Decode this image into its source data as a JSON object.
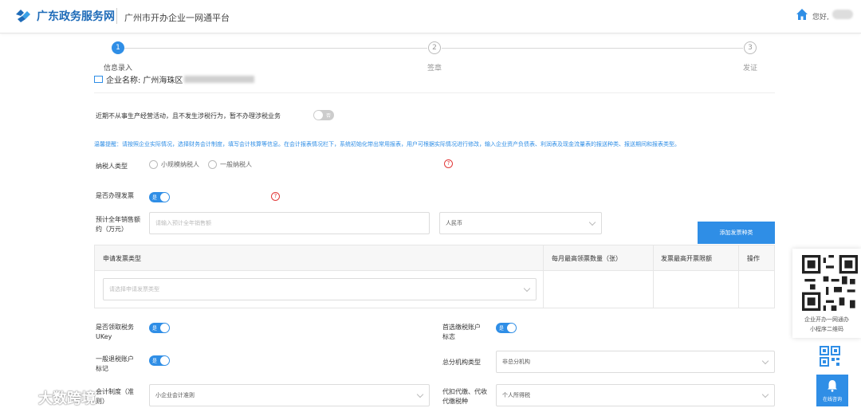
{
  "header": {
    "site_name": "广东政务服务网",
    "subtitle": "广州市开办企业一网通平台",
    "greeting": "您好,"
  },
  "steps": [
    {
      "number": "1",
      "label": "信息录入"
    },
    {
      "number": "2",
      "label": "签章"
    },
    {
      "number": "3",
      "label": "发证"
    }
  ],
  "company": {
    "label": "企业名称:",
    "value": "广州海珠区"
  },
  "form": {
    "no_business_text": "近期不从事生产经营活动，且不发生涉税行为，暂不办理涉税业务",
    "no_business_toggle": "否",
    "tip": "温馨提醒：请按照企业实际情况，选择财务会计制度，填写会计核算等信息。在会计报表情况栏下，系统初始化带出常用报表，用户可根据实际情况进行修改，输入企业资产负债表、利润表及现金流量表的报送种类、报送期间和报表类型。",
    "taxpayer_type_label": "纳税人类型",
    "taxpayer_options": [
      "小规模纳税人",
      "一般纳税人"
    ],
    "invoice_label": "是否办理发票",
    "invoice_toggle": "是",
    "sales_label": "预计全年销售额约（万元）",
    "sales_placeholder": "请输入预计全年销售额",
    "currency_value": "人民币",
    "add_invoice_button": "添加发票种类",
    "table_headers": [
      "申请发票类型",
      "每月最高领票数量（张）",
      "发票最高开票限额",
      "操作"
    ],
    "invoice_type_placeholder": "请选择申请发票类型",
    "ukey_label": "是否领取税务UKey",
    "ukey_toggle": "是",
    "preferred_account_label": "首选缴税账户标志",
    "preferred_account_toggle": "是",
    "refund_account_label": "一般退税账户标记",
    "refund_account_toggle": "是",
    "branch_type_label": "总分机构类型",
    "branch_type_value": "非总分机构",
    "accounting_label": "会计制度（准则）",
    "accounting_value": "小企业会计准则",
    "withholding_label": "代扣代缴、代收代缴税种",
    "withholding_value": "个人所得税"
  },
  "side": {
    "qr_caption": [
      "企业开办一网通办",
      "小程序二维码"
    ],
    "consult_label": "在线咨询"
  },
  "watermark": "大数跨境",
  "colors": {
    "accent": "#2f8ee6",
    "brand": "#1e6bb8",
    "help": "#e23a3a"
  }
}
